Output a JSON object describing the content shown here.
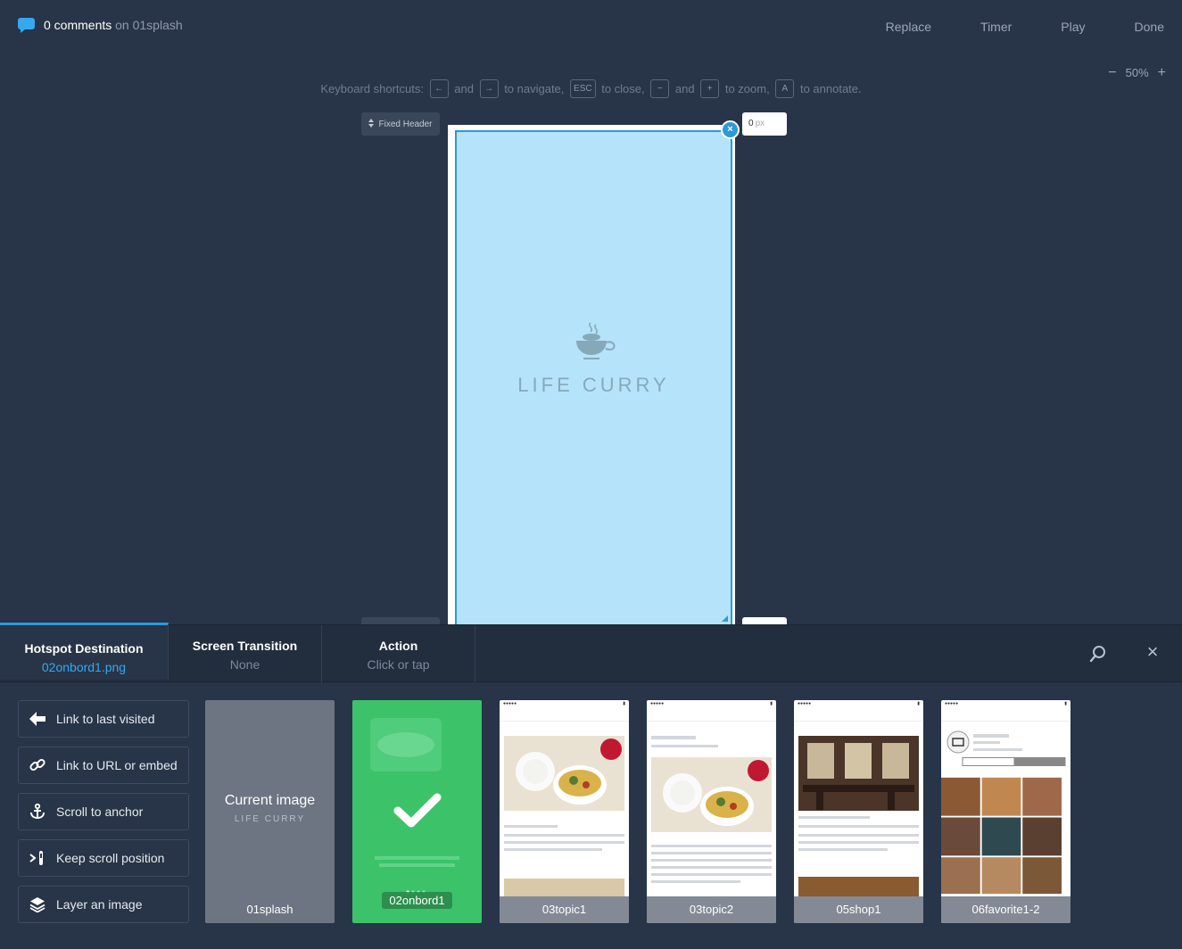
{
  "topbar": {
    "comment_count": "0 comments",
    "comment_on": "on 01splash",
    "nav": [
      "Replace",
      "Timer",
      "Play",
      "Done"
    ]
  },
  "zoom": {
    "minus": "−",
    "level": "50%",
    "plus": "+"
  },
  "shortcuts": {
    "prefix": "Keyboard shortcuts:",
    "k_left": "←",
    "and1": "and",
    "k_right": "→",
    "navigate": "to navigate,",
    "k_esc": "ESC",
    "close": "to close,",
    "k_minus": "−",
    "and2": "and",
    "k_plus": "+",
    "zoom": "to zoom,",
    "k_a": "A",
    "annotate": "to annotate."
  },
  "editor": {
    "fixed_header_label": "Fixed Header",
    "px_value": "0",
    "px_unit": "px",
    "close_glyph": "×",
    "splash_title": "LIFE CURRY"
  },
  "panel": {
    "tabs": [
      {
        "label": "Hotspot Destination",
        "sub": "02onbord1.png"
      },
      {
        "label": "Screen Transition",
        "sub": "None"
      },
      {
        "label": "Action",
        "sub": "Click or tap"
      }
    ],
    "close_glyph": "×",
    "actions": [
      {
        "label": "Link to last visited",
        "icon": "arrow-left-icon"
      },
      {
        "label": "Link to URL or embed",
        "icon": "link-icon"
      },
      {
        "label": "Scroll to anchor",
        "icon": "anchor-icon"
      },
      {
        "label": "Keep scroll position",
        "icon": "scroll-position-icon"
      },
      {
        "label": "Layer an image",
        "icon": "layers-icon"
      }
    ],
    "thumbs": [
      {
        "caption": "01splash",
        "current_label": "Current image",
        "current_sub": "LIFE CURRY"
      },
      {
        "caption": "02onbord1"
      },
      {
        "caption": "03topic1"
      },
      {
        "caption": "03topic2"
      },
      {
        "caption": "05shop1"
      },
      {
        "caption": "06favorite1-2"
      }
    ]
  },
  "colors": {
    "background": "#283447",
    "accent": "#2c9ad8",
    "hotspot_fill": "#b5e3fa",
    "selected_thumb": "#3cc36a"
  }
}
